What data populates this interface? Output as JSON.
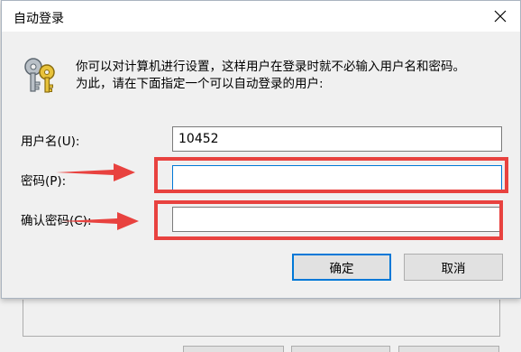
{
  "dialog": {
    "title": "自动登录",
    "description_line1": "你可以对计算机进行设置，这样用户在登录时就不必输入用户名和密码。",
    "description_line2": "为此，请在下面指定一个可以自动登录的用户:",
    "fields": {
      "username_label": "用户名(U):",
      "username_value": "10452",
      "password_label": "密码(P):",
      "password_value": "",
      "confirm_label": "确认密码(C):",
      "confirm_value": ""
    },
    "buttons": {
      "ok_label": "确定",
      "cancel_label": "取消"
    }
  },
  "icons": {
    "close": "close-icon",
    "keys": "keys-icon",
    "annotation_arrow": "arrow-right-icon"
  },
  "colors": {
    "highlight": "#e8423f",
    "focus_border": "#0078d7",
    "dialog_bg": "#f0f0f0",
    "button_bg": "#e1e1e1"
  }
}
